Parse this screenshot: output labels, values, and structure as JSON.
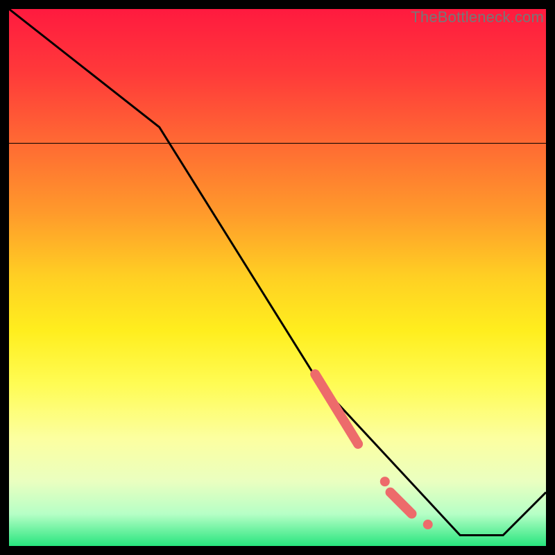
{
  "watermark": "TheBottleneck.com",
  "colors": {
    "frame": "#000000",
    "line": "#000000",
    "marker": "#ed6b6b"
  },
  "chart_data": {
    "type": "line",
    "title": "",
    "xlabel": "",
    "ylabel": "",
    "xlim": [
      0,
      100
    ],
    "ylim": [
      0,
      100
    ],
    "background_gradient": [
      {
        "y": 100,
        "color": "#ff1a3f"
      },
      {
        "y": 88,
        "color": "#ff3a3a"
      },
      {
        "y": 75,
        "color": "#ff6a33"
      },
      {
        "y": 62,
        "color": "#ff9a2b"
      },
      {
        "y": 50,
        "color": "#ffd023"
      },
      {
        "y": 40,
        "color": "#ffee1e"
      },
      {
        "y": 30,
        "color": "#fffc55"
      },
      {
        "y": 20,
        "color": "#fcffa0"
      },
      {
        "y": 12,
        "color": "#eaffc0"
      },
      {
        "y": 6,
        "color": "#b6ffc6"
      },
      {
        "y": 0,
        "color": "#27e57e"
      }
    ],
    "series": [
      {
        "name": "curve",
        "x": [
          0,
          28,
          58,
          84,
          92,
          100
        ],
        "y": [
          100,
          78,
          30,
          2,
          2,
          10
        ]
      }
    ],
    "markers": [
      {
        "type": "thick_segment",
        "x0": 57,
        "y0": 32,
        "x1": 65,
        "y1": 19
      },
      {
        "type": "dot",
        "x": 70,
        "y": 12
      },
      {
        "type": "thick_segment",
        "x0": 71,
        "y0": 10,
        "x1": 75,
        "y1": 6
      },
      {
        "type": "dot",
        "x": 78,
        "y": 4
      }
    ]
  }
}
